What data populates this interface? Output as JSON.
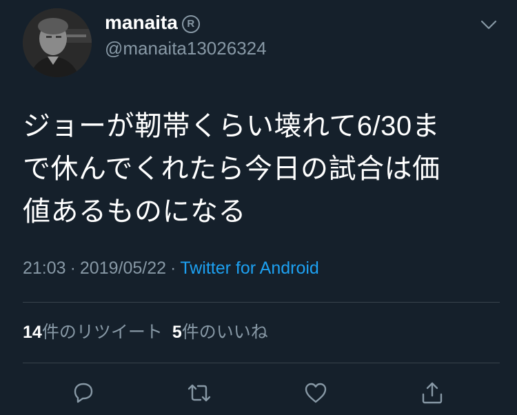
{
  "tweet": {
    "author": {
      "display_name": "manaita",
      "badge_symbol": "R",
      "handle": "@manaita13026324"
    },
    "text_lines": [
      "ジョーが靭帯くらい壊れて6/30ま",
      "で休んでくれたら今日の試合は価",
      "値あるものになる"
    ],
    "time": "21:03",
    "date": "2019/05/22",
    "separator": "·",
    "source": "Twitter for Android",
    "retweets": {
      "count": "14",
      "label": "件のリツイート"
    },
    "likes": {
      "count": "5",
      "label": "件のいいね"
    }
  },
  "icons": {
    "menu": "chevron-down-icon",
    "reply": "reply-icon",
    "retweet": "retweet-icon",
    "like": "heart-icon",
    "share": "share-icon"
  },
  "colors": {
    "background": "#15202b",
    "text_primary": "#ffffff",
    "text_secondary": "#8899a6",
    "link": "#1da1f2",
    "divider": "#38444d"
  }
}
